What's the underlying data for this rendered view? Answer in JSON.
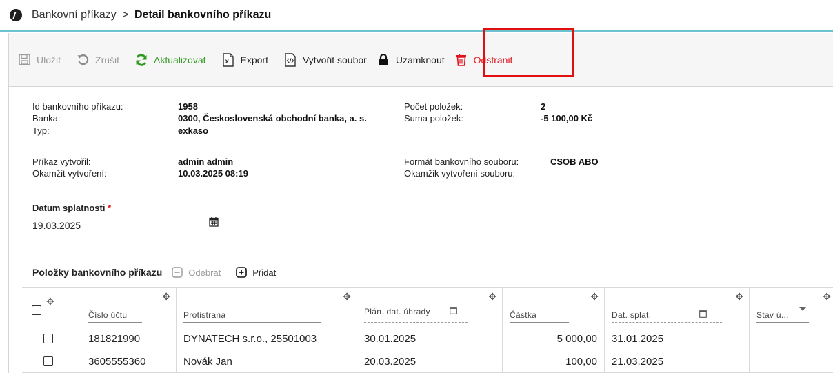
{
  "header": {
    "breadcrumb_parent": "Bankovní příkazy",
    "breadcrumb_separator": ">",
    "breadcrumb_current": "Detail bankovního příkazu"
  },
  "toolbar": {
    "save": {
      "label": "Uložit",
      "icon": "save-icon",
      "state": "disabled"
    },
    "cancel": {
      "label": "Zrušit",
      "icon": "undo-icon",
      "state": "disabled"
    },
    "refresh": {
      "label": "Aktualizovat",
      "icon": "refresh-icon",
      "color": "#2e9b1f"
    },
    "export": {
      "label": "Export",
      "icon": "excel-icon"
    },
    "create_file": {
      "label": "Vytvořit soubor",
      "icon": "code-file-icon"
    },
    "lock": {
      "label": "Uzamknout",
      "icon": "lock-icon"
    },
    "delete": {
      "label": "Odstranit",
      "icon": "trash-icon",
      "color": "#e0141e"
    }
  },
  "detail": {
    "id_label": "Id bankovního příkazu:",
    "id_value": "1958",
    "bank_label": "Banka:",
    "bank_value": "0300, Československá obchodní banka, a. s.",
    "type_label": "Typ:",
    "type_value": "exkaso",
    "count_label": "Počet položek:",
    "count_value": "2",
    "sum_label": "Suma položek:",
    "sum_value": "-5 100,00 Kč",
    "created_by_label": "Příkaz vytvořil:",
    "created_by_value": "admin admin",
    "created_at_label": "Okamžit vytvoření:",
    "created_at_value": "10.03.2025 08:19",
    "format_label": "Formát bankovního souboru:",
    "format_value": "CSOB ABO",
    "file_created_label": "Okamžik vytvoření souboru:",
    "file_created_value": "--"
  },
  "due_date": {
    "label": "Datum splatnosti",
    "required_mark": "*",
    "value": "19.03.2025"
  },
  "items": {
    "title": "Položky bankovního příkazu",
    "remove_label": "Odebrat",
    "add_label": "Přidat",
    "columns": [
      "Číslo účtu",
      "Protistrana",
      "Plán. dat. úhrady",
      "Částka",
      "Dat. splat.",
      "Stav ú..."
    ],
    "rows": [
      {
        "account": "181821990",
        "counterparty": "DYNATECH s.r.o., 25501003",
        "planned": "30.01.2025",
        "amount": "5 000,00",
        "due": "31.01.2025",
        "status": ""
      },
      {
        "account": "3605555360",
        "counterparty": "Novák Jan",
        "planned": "20.03.2025",
        "amount": "100,00",
        "due": "21.03.2025",
        "status": ""
      }
    ]
  },
  "colors": {
    "accent_line": "#6cc3cf",
    "highlight_box": "#e01010"
  }
}
